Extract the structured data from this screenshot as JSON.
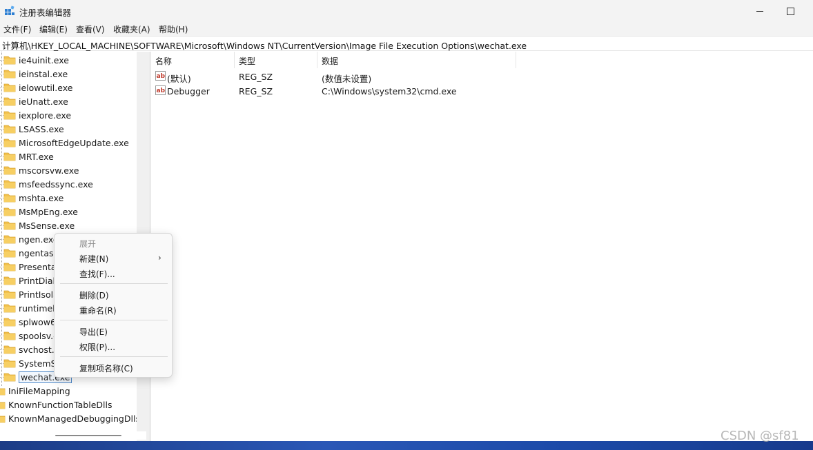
{
  "window": {
    "title": "注册表编辑器"
  },
  "menubar": [
    "文件(F)",
    "编辑(E)",
    "查看(V)",
    "收藏夹(A)",
    "帮助(H)"
  ],
  "address": "计算机\\HKEY_LOCAL_MACHINE\\SOFTWARE\\Microsoft\\Windows NT\\CurrentVersion\\Image File Execution Options\\wechat.exe",
  "tree": {
    "children": [
      "ie4uinit.exe",
      "ieinstal.exe",
      "ielowutil.exe",
      "ieUnatt.exe",
      "iexplore.exe",
      "LSASS.exe",
      "MicrosoftEdgeUpdate.exe",
      "MRT.exe",
      "mscorsvw.exe",
      "msfeedssync.exe",
      "mshta.exe",
      "MsMpEng.exe",
      "MsSense.exe",
      "ngen.exe",
      "ngentask.exe",
      "PresentationHost.exe",
      "PrintDialog.exe",
      "PrintIsolationHost.exe",
      "runtimebroker.exe",
      "splwow64.exe",
      "spoolsv.exe",
      "svchost.exe",
      "SystemSettings.exe",
      "wechat.exe"
    ],
    "selected": "wechat.exe",
    "siblings": [
      "IniFileMapping",
      "KnownFunctionTableDlls",
      "KnownManagedDebuggingDlls"
    ]
  },
  "list": {
    "headers": {
      "name": "名称",
      "type": "类型",
      "data": "数据"
    },
    "rows": [
      {
        "name": "(默认)",
        "type": "REG_SZ",
        "data": "(数值未设置)"
      },
      {
        "name": "Debugger",
        "type": "REG_SZ",
        "data": "C:\\Windows\\system32\\cmd.exe"
      }
    ]
  },
  "context_menu": {
    "expand": "展开",
    "new": "新建(N)",
    "find": "查找(F)...",
    "delete": "删除(D)",
    "rename": "重命名(R)",
    "export": "导出(E)",
    "permissions": "权限(P)...",
    "copy_key_name": "复制项名称(C)"
  },
  "watermark": "CSDN @sf81",
  "colors": {
    "folder": "#f2c14e",
    "selection_border": "#4a86c8",
    "taskbar": "#1e3f8a"
  }
}
